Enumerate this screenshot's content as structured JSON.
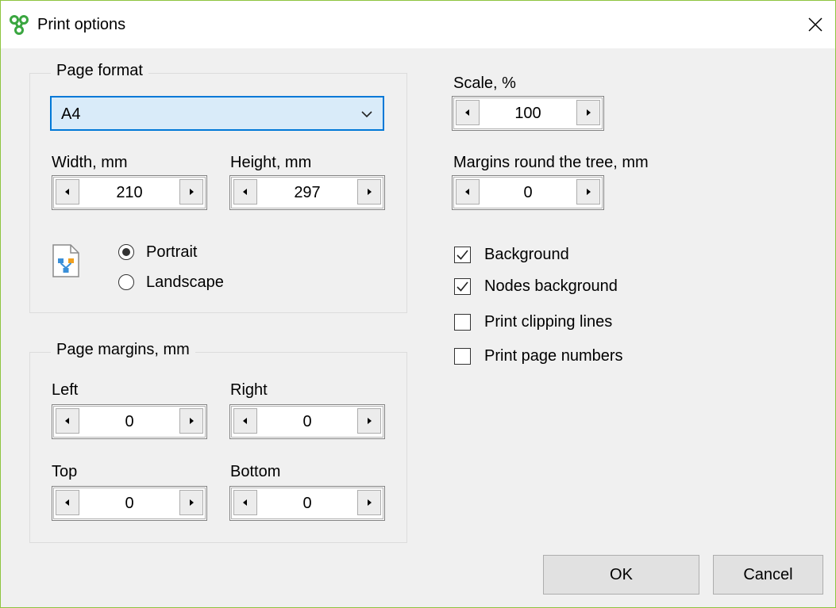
{
  "window": {
    "title": "Print options",
    "border_color": "#8ec53f",
    "app_icon": "green-tree-logo-icon",
    "close_icon": "close-icon"
  },
  "page_format": {
    "legend": "Page format",
    "format_selected": "A4",
    "width_label": "Width, mm",
    "width_value": "210",
    "height_label": "Height, mm",
    "height_value": "297",
    "orientation_icon": "page-orientation-icon",
    "portrait_label": "Portrait",
    "landscape_label": "Landscape",
    "orientation_selected": "Portrait"
  },
  "page_margins": {
    "legend": "Page margins, mm",
    "left_label": "Left",
    "left_value": "0",
    "right_label": "Right",
    "right_value": "0",
    "top_label": "Top",
    "top_value": "0",
    "bottom_label": "Bottom",
    "bottom_value": "0"
  },
  "options": {
    "scale_label": "Scale, %",
    "scale_value": "100",
    "tree_margins_label": "Margins round the tree, mm",
    "tree_margins_value": "0",
    "checkboxes": [
      {
        "label": "Background",
        "checked": true
      },
      {
        "label": "Nodes background",
        "checked": true
      },
      {
        "label": "Print clipping lines",
        "checked": false
      },
      {
        "label": "Print page numbers",
        "checked": false
      }
    ]
  },
  "buttons": {
    "ok": "OK",
    "cancel": "Cancel"
  },
  "colors": {
    "accent": "#0078d7",
    "select_bg": "#d9ebf9",
    "dialog_bg": "#f0f0f0"
  }
}
